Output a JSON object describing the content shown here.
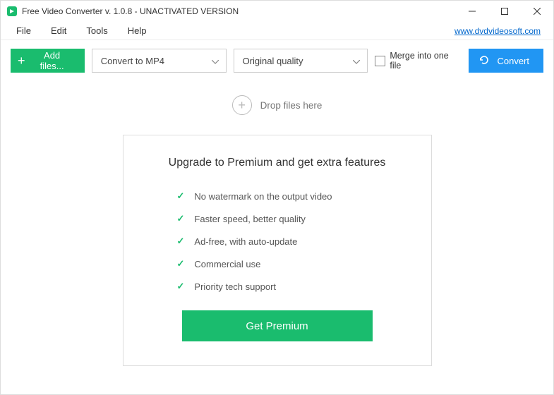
{
  "titlebar": {
    "title": "Free Video Converter v. 1.0.8 - UNACTIVATED VERSION"
  },
  "menu": {
    "file": "File",
    "edit": "Edit",
    "tools": "Tools",
    "help": "Help",
    "link": "www.dvdvideosoft.com"
  },
  "toolbar": {
    "add_files": "Add files...",
    "format_selected": "Convert to MP4",
    "quality_selected": "Original quality",
    "merge_label": "Merge into one file",
    "convert": "Convert"
  },
  "drop": {
    "hint": "Drop files here"
  },
  "upgrade": {
    "title": "Upgrade to Premium and get extra features",
    "features": [
      "No watermark on the output video",
      "Faster speed, better quality",
      "Ad-free, with auto-update",
      "Commercial use",
      "Priority tech support"
    ],
    "button": "Get Premium"
  }
}
